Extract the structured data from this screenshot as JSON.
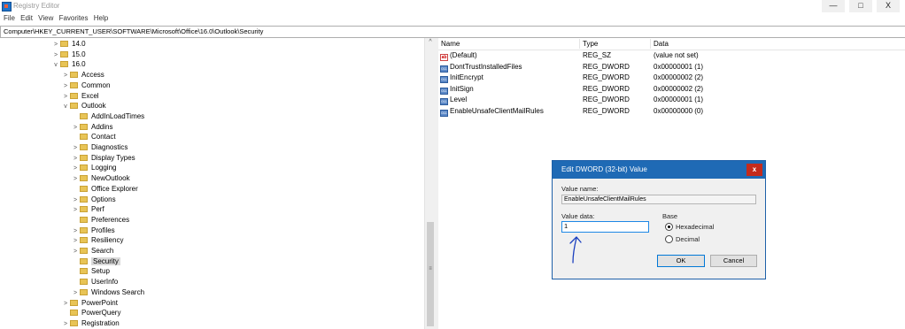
{
  "window": {
    "title": "Registry Editor",
    "minimize": "—",
    "maximize": "□",
    "close": "X"
  },
  "menu": [
    "File",
    "Edit",
    "View",
    "Favorites",
    "Help"
  ],
  "address": "Computer\\HKEY_CURRENT_USER\\SOFTWARE\\Microsoft\\Office\\16.0\\Outlook\\Security",
  "tree": [
    {
      "label": "14.0",
      "level": 0,
      "chevron": ">"
    },
    {
      "label": "15.0",
      "level": 0,
      "chevron": ">"
    },
    {
      "label": "16.0",
      "level": 0,
      "chevron": "v"
    },
    {
      "label": "Access",
      "level": 1,
      "chevron": ">"
    },
    {
      "label": "Common",
      "level": 1,
      "chevron": ">"
    },
    {
      "label": "Excel",
      "level": 1,
      "chevron": ">"
    },
    {
      "label": "Outlook",
      "level": 1,
      "chevron": "v"
    },
    {
      "label": "AddInLoadTimes",
      "level": 2,
      "chevron": ""
    },
    {
      "label": "Addins",
      "level": 2,
      "chevron": ">"
    },
    {
      "label": "Contact",
      "level": 2,
      "chevron": ""
    },
    {
      "label": "Diagnostics",
      "level": 2,
      "chevron": ">"
    },
    {
      "label": "Display Types",
      "level": 2,
      "chevron": ">"
    },
    {
      "label": "Logging",
      "level": 2,
      "chevron": ">"
    },
    {
      "label": "NewOutlook",
      "level": 2,
      "chevron": ">"
    },
    {
      "label": "Office Explorer",
      "level": 2,
      "chevron": ""
    },
    {
      "label": "Options",
      "level": 2,
      "chevron": ">"
    },
    {
      "label": "Perf",
      "level": 2,
      "chevron": ">"
    },
    {
      "label": "Preferences",
      "level": 2,
      "chevron": ""
    },
    {
      "label": "Profiles",
      "level": 2,
      "chevron": ">"
    },
    {
      "label": "Resiliency",
      "level": 2,
      "chevron": ">"
    },
    {
      "label": "Search",
      "level": 2,
      "chevron": ">"
    },
    {
      "label": "Security",
      "level": 2,
      "chevron": "",
      "selected": true
    },
    {
      "label": "Setup",
      "level": 2,
      "chevron": ""
    },
    {
      "label": "UserInfo",
      "level": 2,
      "chevron": ""
    },
    {
      "label": "Windows Search",
      "level": 2,
      "chevron": ">"
    },
    {
      "label": "PowerPoint",
      "level": 1,
      "chevron": ">"
    },
    {
      "label": "PowerQuery",
      "level": 1,
      "chevron": ""
    },
    {
      "label": "Registration",
      "level": 1,
      "chevron": ">"
    }
  ],
  "list": {
    "headers": {
      "name": "Name",
      "type": "Type",
      "data": "Data"
    },
    "rows": [
      {
        "name": "(Default)",
        "type": "REG_SZ",
        "data": "(value not set)",
        "icon": "string-value-icon"
      },
      {
        "name": "DontTrustInstalledFiles",
        "type": "REG_DWORD",
        "data": "0x00000001 (1)",
        "icon": "dword-value-icon"
      },
      {
        "name": "InitEncrypt",
        "type": "REG_DWORD",
        "data": "0x00000002 (2)",
        "icon": "dword-value-icon"
      },
      {
        "name": "InitSign",
        "type": "REG_DWORD",
        "data": "0x00000002 (2)",
        "icon": "dword-value-icon"
      },
      {
        "name": "Level",
        "type": "REG_DWORD",
        "data": "0x00000001 (1)",
        "icon": "dword-value-icon"
      },
      {
        "name": "EnableUnsafeClientMailRules",
        "type": "REG_DWORD",
        "data": "0x00000000 (0)",
        "icon": "dword-value-icon"
      }
    ]
  },
  "dialog": {
    "title": "Edit DWORD (32-bit) Value",
    "close": "x",
    "value_name_label": "Value name:",
    "value_name": "EnableUnsafeClientMailRules",
    "value_data_label": "Value data:",
    "value_data": "1",
    "base_label": "Base",
    "hex_label": "Hexadecimal",
    "dec_label": "Decimal",
    "base_selected": "Hexadecimal",
    "ok": "OK",
    "cancel": "Cancel"
  },
  "colors": {
    "dialog_title_bg": "#1f6ab5",
    "close_red": "#c42b1c",
    "annotation_ink": "#1a3fbf"
  }
}
